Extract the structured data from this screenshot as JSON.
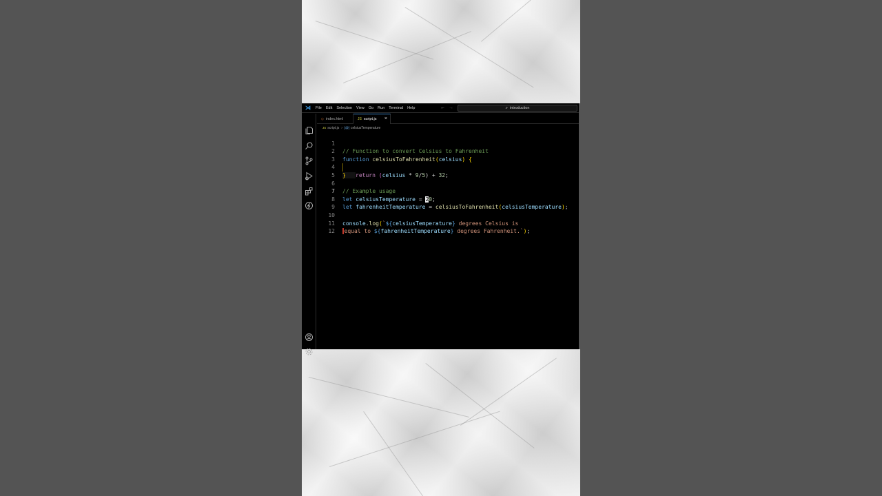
{
  "menu": {
    "items": [
      "File",
      "Edit",
      "Selection",
      "View",
      "Go",
      "Run",
      "Terminal",
      "Help"
    ]
  },
  "search": {
    "text": "introduction"
  },
  "tabs": [
    {
      "label": "index.html",
      "icon": "html-file-icon",
      "active": false
    },
    {
      "label": "script.js",
      "icon": "js-file-icon",
      "active": true
    }
  ],
  "breadcrumb": {
    "file": "script.js",
    "symbol": "celsiusTemperature"
  },
  "editor": {
    "line_numbers": [
      "1",
      "2",
      "3",
      "4",
      "5",
      "6",
      "7",
      "8",
      "9",
      "10",
      "11",
      "12"
    ],
    "current_line": "7",
    "lines": {
      "l1": "// Function to convert Celsius to Fahrenheit",
      "l2_kw": "function",
      "l2_fn": "celsiusToFahrenheit",
      "l2_param": "celsius",
      "l3_kw": "return",
      "l3_var": "celsius",
      "l3_op1": " * ",
      "l3_num1": "9",
      "l3_op2": "/",
      "l3_num2": "5",
      "l3_op3": ") + ",
      "l3_num3": "32",
      "l6": "// Example usage",
      "l7_kw": "let",
      "l7_var": "celsiusTemperature",
      "l7_cursor": "2",
      "l7_rest": "0",
      "l8_kw": "let",
      "l8_var": "fahrenheitTemperature",
      "l8_fn": "celsiusToFahrenheit",
      "l8_arg": "celsiusTemperature",
      "l10_obj": "console",
      "l10_fn": "log",
      "l10_var": "celsiusTemperature",
      "l10_str": " degrees Celsius is",
      "l11_str1": "equal to ",
      "l11_var": "fahrenheitTemperature",
      "l11_str2": " degrees Fahrenheit."
    }
  },
  "colors": {
    "accent": "#3b82c4",
    "background": "#000000",
    "comment": "#6a9955",
    "keyword": "#569cd6",
    "function": "#dcdcaa",
    "variable": "#9cdcfe",
    "string": "#ce9178"
  }
}
